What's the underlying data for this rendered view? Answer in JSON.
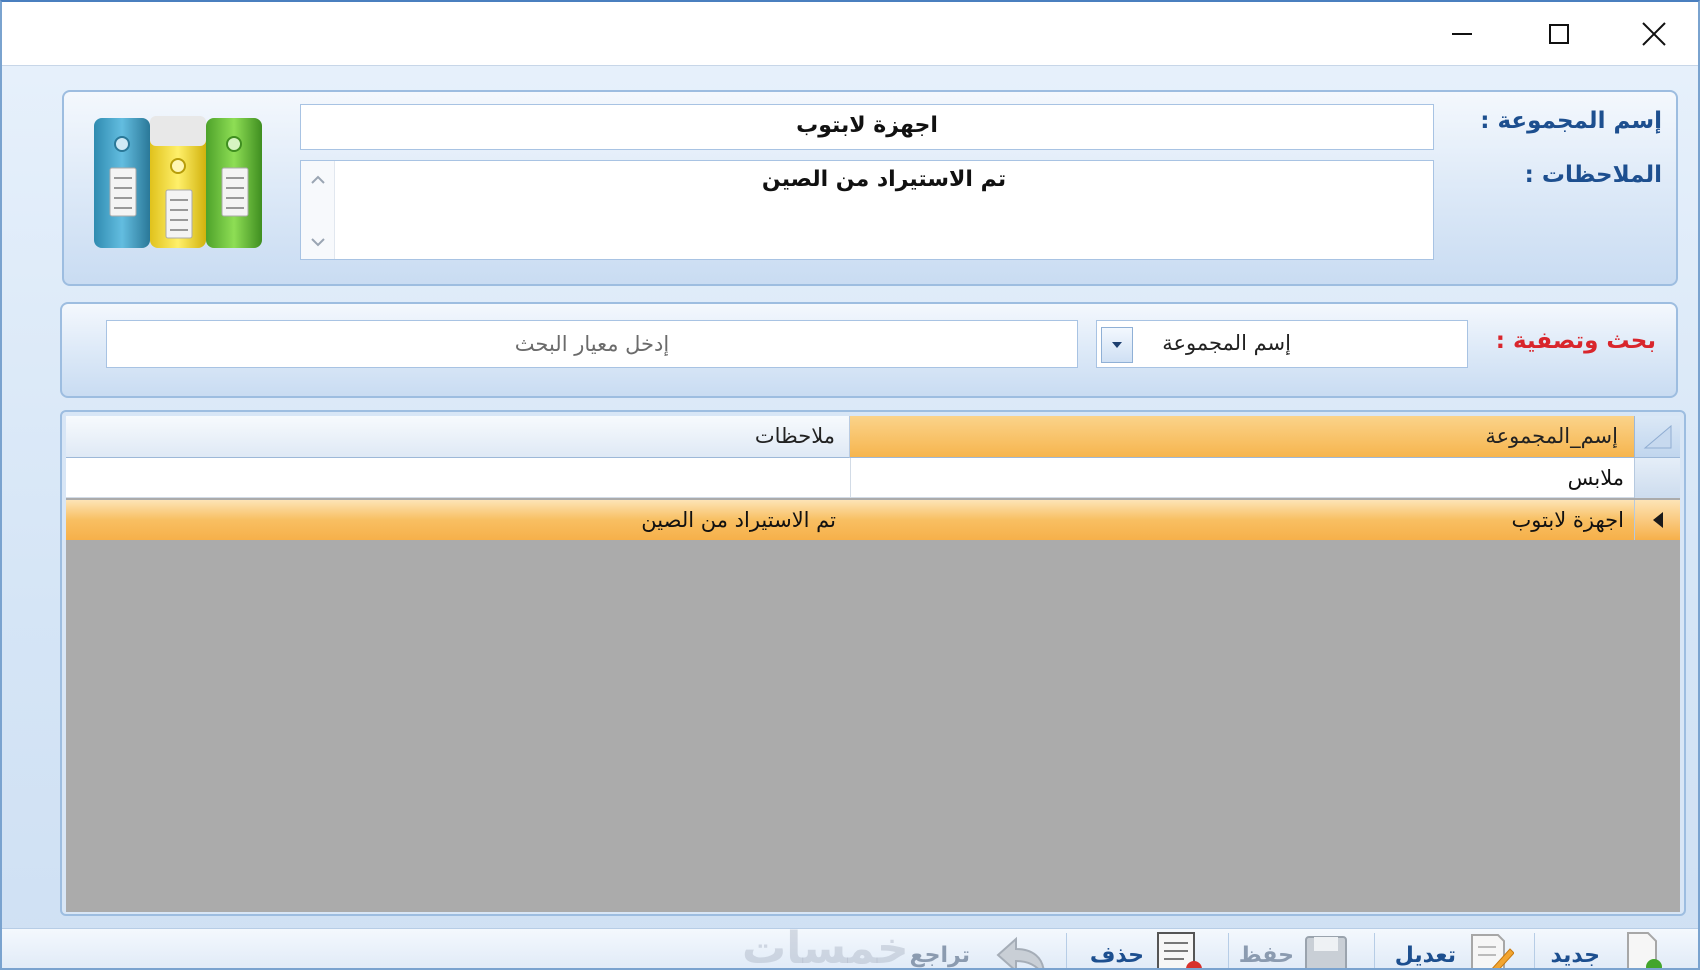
{
  "form": {
    "group_name_label": "إسم المجموعة :",
    "group_name_value": "اجهزة لابتوب",
    "notes_label": "الملاحظات :",
    "notes_value": "تم الاستيراد من الصين"
  },
  "search": {
    "label": "بحث وتصفية :",
    "field_selected": "إسم المجموعة",
    "placeholder": "إدخل معيار البحث"
  },
  "grid": {
    "columns": [
      "إسم_المجموعة",
      "ملاحظات"
    ],
    "rows": [
      {
        "name": "ملابس",
        "notes": ""
      },
      {
        "name": "اجهزة لابتوب",
        "notes": "تم الاستيراد من الصين",
        "selected": true
      }
    ]
  },
  "toolbar": {
    "new_label": "جديد",
    "edit_label": "تعديل",
    "save_label": "حفظ",
    "delete_label": "حذف",
    "undo_label": "تراجع"
  },
  "watermark": "خمسات",
  "colors": {
    "accent_blue": "#1d4f8f",
    "search_label_red": "#d9262c",
    "selected_row_orange": "#f6b04a",
    "grid_background": "#ababab"
  }
}
